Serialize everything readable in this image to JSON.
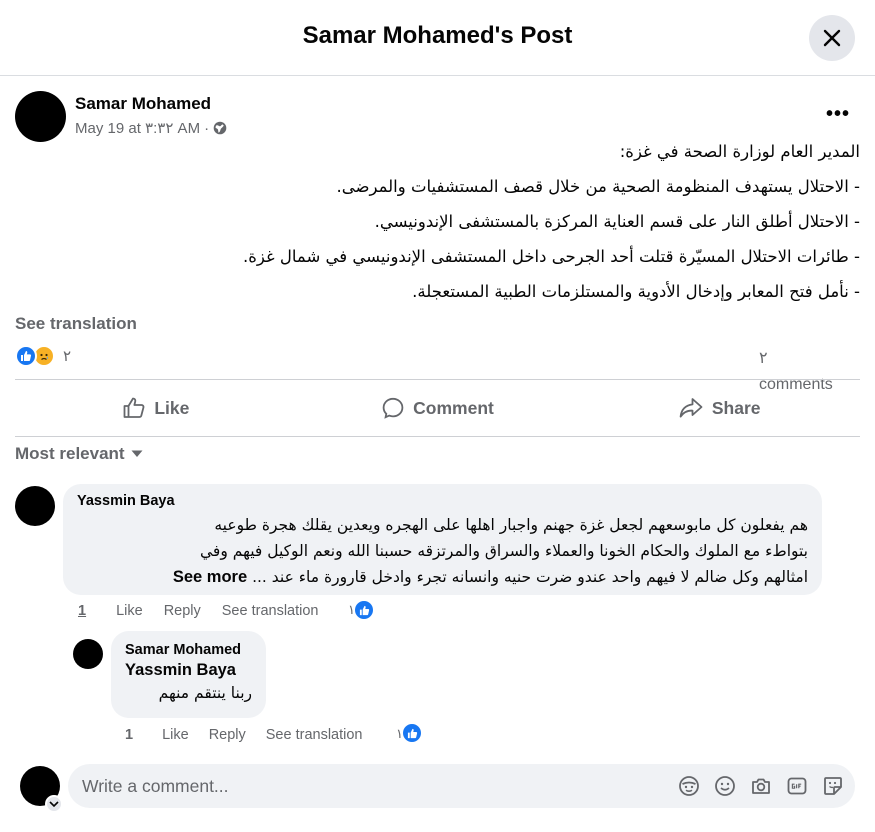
{
  "header": {
    "title": "Samar Mohamed's Post"
  },
  "post": {
    "author": "Samar Mohamed",
    "date": "May 19 at ٣:٣٢ AM",
    "privacy_separator": "·",
    "more_label": "•••",
    "lines": [
      "المدير العام لوزارة الصحة في غزة:",
      "- الاحتلال يستهدف المنظومة الصحية من خلال قصف المستشفيات والمرضى.",
      "- الاحتلال أطلق النار على قسم العناية المركزة بالمستشفى الإندونيسي.",
      "- طائرات الاحتلال المسيّرة قتلت أحد الجرحى داخل المستشفى الإندونيسي في شمال غزة.",
      "- نأمل فتح المعابر وإدخال الأدوية والمستلزمات الطبية المستعجلة."
    ],
    "see_translation": "See translation",
    "reaction_count": "٢",
    "comments_count": "٢",
    "comments_label": "comments"
  },
  "actions": {
    "like": "Like",
    "comment": "Comment",
    "share": "Share"
  },
  "sort": {
    "label": "Most relevant"
  },
  "comments": [
    {
      "author": "Yassmin Baya",
      "lines": [
        "هم يفعلون كل مابوسعهم لجعل غزة جهنم واجبار اهلها على الهجره ويعدين يقلك هجرة طوعيه",
        "بتواطء مع الملوك والحكام الخونا والعملاء والسراق والمرتزقه حسبنا الله ونعم الوكيل فيهم وفي",
        "امثالهم وكل ضالم لا فيهم واحد عندو ضرت حنيه وانسانه تجرء وادخل قارورة ماء عند ..."
      ],
      "see_more": "See more",
      "time": "1",
      "like": "Like",
      "reply": "Reply",
      "see_translation": "See translation",
      "like_count": "١"
    },
    {
      "author": "Samar Mohamed",
      "mention": "Yassmin Baya",
      "text": "ربنا ينتقم منهم",
      "time": "1",
      "like": "Like",
      "reply": "Reply",
      "see_translation": "See translation",
      "like_count": "١"
    }
  ],
  "composer": {
    "placeholder": "Write a comment..."
  },
  "colors": {
    "accent": "#1877f2",
    "muted": "#65676b",
    "bubble": "#f0f2f5"
  }
}
